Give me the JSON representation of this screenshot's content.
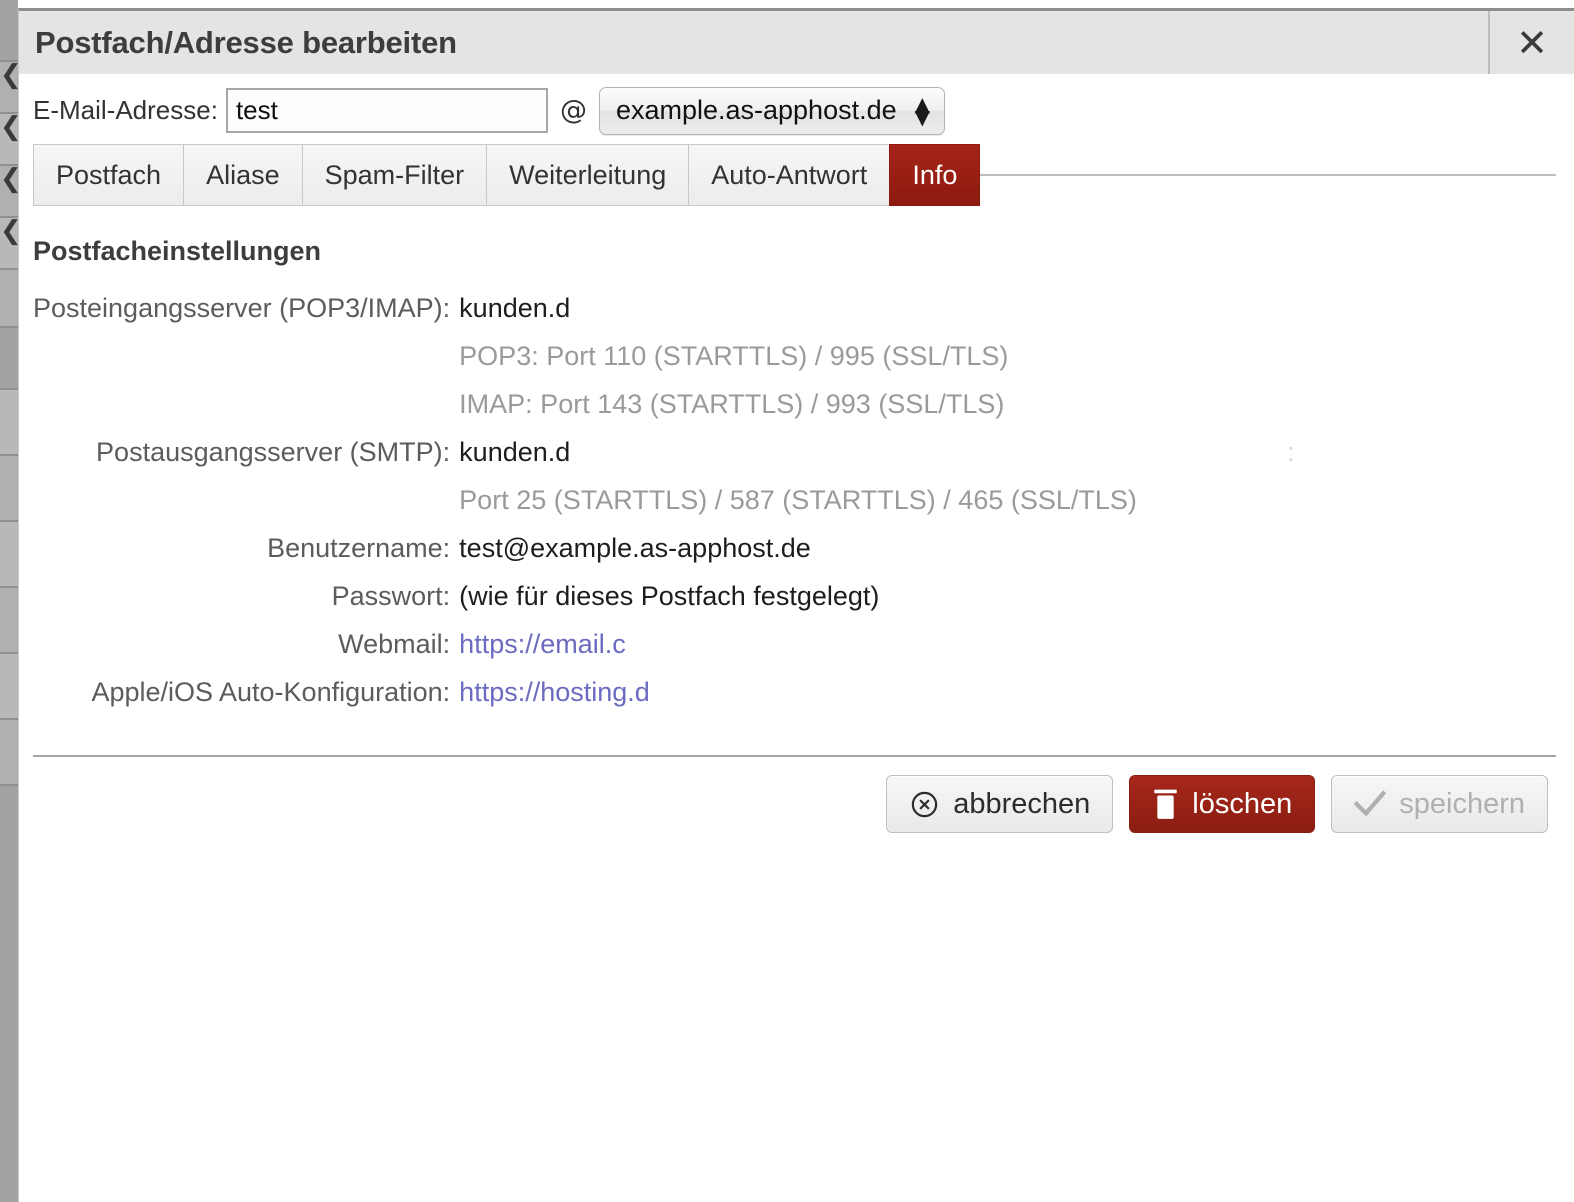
{
  "dialog": {
    "title": "Postfach/Adresse bearbeiten",
    "close_icon": "close-icon"
  },
  "address": {
    "label": "E-Mail-Adresse:",
    "local_part_value": "test",
    "local_part_placeholder": "",
    "at": "@",
    "domain_selected": "example.as-apphost.de"
  },
  "tabs": [
    {
      "label": "Postfach",
      "active": false
    },
    {
      "label": "Aliase",
      "active": false
    },
    {
      "label": "Spam-Filter",
      "active": false
    },
    {
      "label": "Weiterleitung",
      "active": false
    },
    {
      "label": "Auto-Antwort",
      "active": false
    },
    {
      "label": "Info",
      "active": true
    }
  ],
  "content": {
    "section_title": "Postfacheinstellungen",
    "rows": {
      "incoming_label": "Posteingangsserver (POP3/IMAP):",
      "incoming_value": "kunden.d",
      "incoming_pop3_hint": "POP3: Port 110 (STARTTLS) / 995 (SSL/TLS)",
      "incoming_imap_hint": "IMAP: Port 143 (STARTTLS) / 993 (SSL/TLS)",
      "outgoing_label": "Postausgangsserver (SMTP):",
      "outgoing_value": "kunden.d",
      "outgoing_ghost": ":",
      "outgoing_hint": "Port 25 (STARTTLS) / 587 (STARTTLS) / 465 (SSL/TLS)",
      "username_label": "Benutzername:",
      "username_value": "test@example.as-apphost.de",
      "password_label": "Passwort:",
      "password_value": "(wie für dieses Postfach festgelegt)",
      "webmail_label": "Webmail:",
      "webmail_value": "https://email.c",
      "apple_label": "Apple/iOS Auto-Konfiguration:",
      "apple_value": "https://hosting.d"
    }
  },
  "footer": {
    "cancel_label": "abbrechen",
    "cancel_icon": "cancel-circle-icon",
    "delete_label": "löschen",
    "delete_icon": "trash-icon",
    "save_label": "speichern",
    "save_icon": "checkmark-icon"
  },
  "colors": {
    "accent_red": "#a62418",
    "link_violet": "#6b6bc0",
    "header_gray": "#e4e4e4",
    "hint_gray": "#9a9a9a"
  }
}
